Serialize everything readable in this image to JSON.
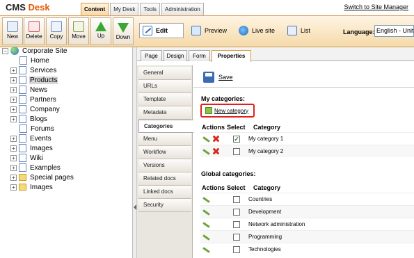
{
  "header": {
    "logo_cms": "CMS",
    "logo_desk": "Desk",
    "tabs": [
      "Content",
      "My Desk",
      "Tools",
      "Administration"
    ],
    "switch_link": "Switch to Site Manager"
  },
  "toolbar": {
    "buttons": [
      "New",
      "Delete",
      "Copy",
      "Move",
      "Up",
      "Down"
    ],
    "modes": [
      "Edit",
      "Preview",
      "Live site",
      "List"
    ],
    "language_label": "Language:",
    "language_value": "English - United States"
  },
  "tree": {
    "root": "Corporate Site",
    "items": [
      "Home",
      "Services",
      "Products",
      "News",
      "Partners",
      "Company",
      "Blogs",
      "Forums",
      "Events",
      "Images",
      "Wiki",
      "Examples",
      "Special pages",
      "Images"
    ]
  },
  "subtabs": [
    "Page",
    "Design",
    "Form",
    "Properties"
  ],
  "side_menu": [
    "General",
    "URLs",
    "Template",
    "Metadata",
    "Categories",
    "Menu",
    "Workflow",
    "Versions",
    "Related docs",
    "Linked docs",
    "Security"
  ],
  "content": {
    "save_label": "Save",
    "my_categories_title": "My categories:",
    "new_category": "New category",
    "headers": [
      "Actions",
      "Select",
      "Category"
    ],
    "my_categories": [
      "My category 1",
      "My category 2"
    ],
    "global_categories_title": "Global categories:",
    "global_categories": [
      "Countries",
      "Development",
      "Network administration",
      "Programming",
      "Technologies"
    ]
  }
}
